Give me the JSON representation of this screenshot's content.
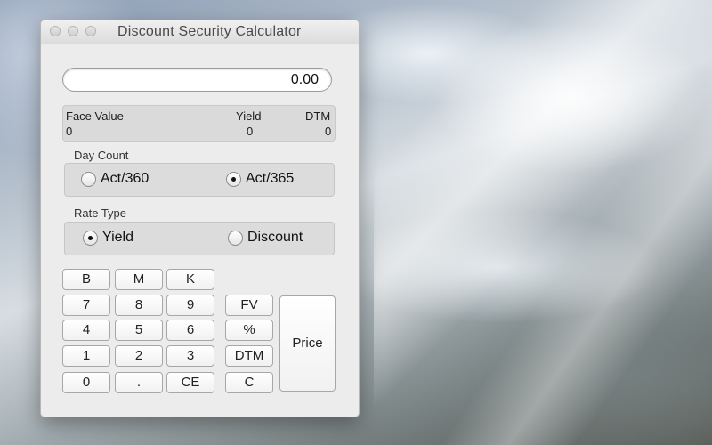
{
  "window": {
    "title": "Discount Security Calculator"
  },
  "display": {
    "value": "0.00"
  },
  "info": {
    "face_value_label": "Face Value",
    "face_value": "0",
    "yield_label": "Yield",
    "yield_value": "0",
    "dtm_label": "DTM",
    "dtm_value": "0"
  },
  "day_count": {
    "label": "Day Count",
    "options": [
      "Act/360",
      "Act/365"
    ],
    "selected": "Act/365"
  },
  "rate_type": {
    "label": "Rate Type",
    "options": [
      "Yield",
      "Discount"
    ],
    "selected": "Yield"
  },
  "keypad": {
    "b": "B",
    "m": "M",
    "k": "K",
    "k7": "7",
    "k8": "8",
    "k9": "9",
    "k4": "4",
    "k5": "5",
    "k6": "6",
    "k1": "1",
    "k2": "2",
    "k3": "3",
    "k0": "0",
    "dot": ".",
    "ce": "CE",
    "fv": "FV",
    "pct": "%",
    "dtm": "DTM",
    "c": "C",
    "price": "Price"
  }
}
